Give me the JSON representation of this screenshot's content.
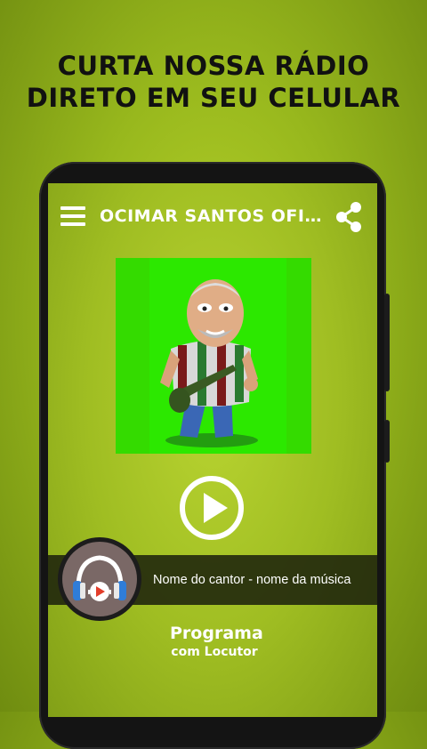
{
  "promo": {
    "line1": "CURTA NOSSA RÁDIO",
    "line2": "DIRETO EM SEU CELULAR"
  },
  "app": {
    "title": "OCIMAR SANTOS OFICI...",
    "menu_icon": "hamburger-menu-icon",
    "share_icon": "share-icon"
  },
  "player": {
    "play_icon": "play-icon",
    "now_playing": "Nome do cantor - nome da música",
    "logo_icon": "headphones-play-icon"
  },
  "program": {
    "name": "Programa",
    "host": "com Locutor"
  },
  "colors": {
    "background": "#98b81d",
    "cover_green": "#33dd00",
    "text": "#ffffff"
  }
}
